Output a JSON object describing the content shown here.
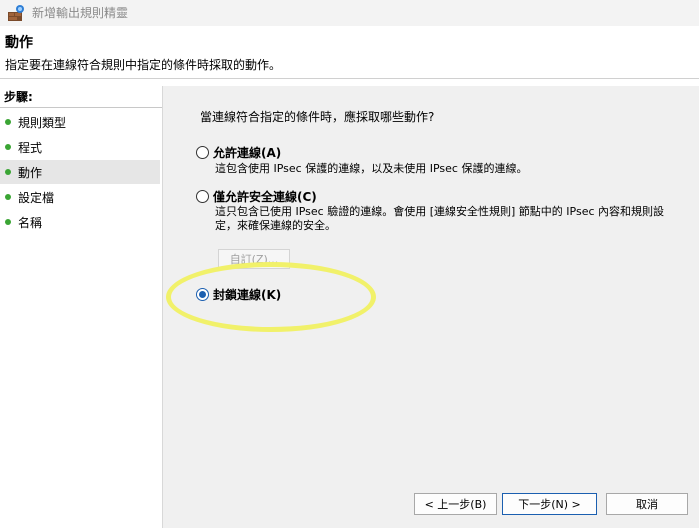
{
  "window": {
    "title": "新增輸出規則精靈"
  },
  "header": {
    "title": "動作",
    "description": "指定要在連線符合規則中指定的條件時採取的動作。"
  },
  "sidebar": {
    "steps_label": "步驟:",
    "items": [
      {
        "label": "規則類型"
      },
      {
        "label": "程式"
      },
      {
        "label": "動作"
      },
      {
        "label": "設定檔"
      },
      {
        "label": "名稱"
      }
    ],
    "active_index": 2
  },
  "main": {
    "question": "當連線符合指定的條件時，應採取哪些動作?",
    "options": [
      {
        "label": "允許連線(A)",
        "description": "這包含使用 IPsec 保護的連線，以及未使用 IPsec 保護的連線。",
        "selected": false
      },
      {
        "label": "僅允許安全連線(C)",
        "description": "這只包含已使用 IPsec 驗證的連線。會使用 [連線安全性規則] 節點中的 IPsec 內容和規則設定，來確保連線的安全。",
        "selected": false
      },
      {
        "label": "封鎖連線(K)",
        "description": "",
        "selected": true
      }
    ],
    "customize_label": "自訂(Z)..."
  },
  "buttons": {
    "back": "< 上一步(B)",
    "next": "下一步(N) >",
    "cancel": "取消"
  },
  "colors": {
    "accent": "#1b5fb0",
    "bullet": "#3aa534",
    "highlight": "#f1f16a"
  }
}
